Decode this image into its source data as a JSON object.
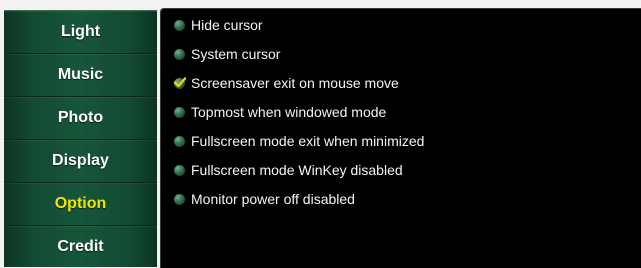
{
  "sidebar": {
    "items": [
      {
        "label": "Light",
        "active": false
      },
      {
        "label": "Music",
        "active": false
      },
      {
        "label": "Photo",
        "active": false
      },
      {
        "label": "Display",
        "active": false
      },
      {
        "label": "Option",
        "active": true
      },
      {
        "label": "Credit",
        "active": false
      }
    ]
  },
  "options": [
    {
      "label": "Hide cursor",
      "checked": false
    },
    {
      "label": "System cursor",
      "checked": false
    },
    {
      "label": "Screensaver exit on mouse move",
      "checked": true
    },
    {
      "label": "Topmost when windowed mode",
      "checked": false
    },
    {
      "label": "Fullscreen mode exit when minimized",
      "checked": false
    },
    {
      "label": "Fullscreen mode WinKey disabled",
      "checked": false
    },
    {
      "label": "Monitor power off disabled",
      "checked": false
    }
  ],
  "colors": {
    "active_nav": "#f2e600",
    "checkmark": "#f2d21a",
    "radio": "#3b7b58"
  }
}
